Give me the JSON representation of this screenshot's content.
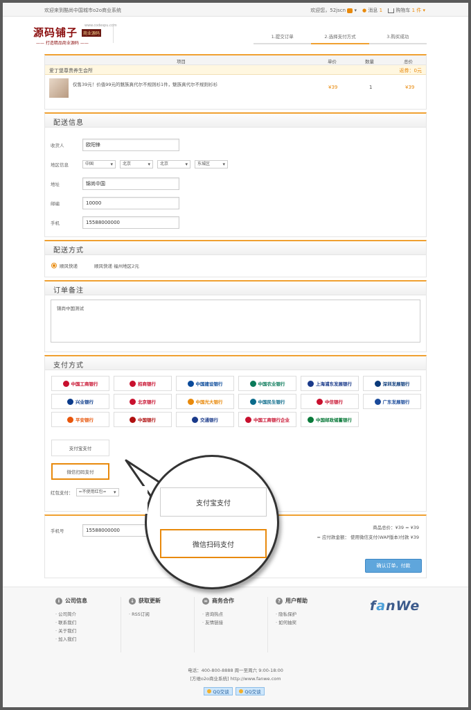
{
  "topbar": {
    "welcome": "欢迎来到酷尚中国城市o2o商业系统",
    "greeting": "欢迎您，52jscn",
    "messages": "消息",
    "message_count": "1",
    "cart": "购物车",
    "cart_count": "1 件"
  },
  "logo": {
    "name": "源码铺子",
    "badge": "商业源码",
    "site": "www.codespu.com",
    "slogan": "—— 打造精品商业源码 ——"
  },
  "steps": [
    "1.提交订单",
    "2.选择支付方式",
    "3.购买成功"
  ],
  "active_step": 1,
  "cart": {
    "headers": {
      "item": "项目",
      "price": "单价",
      "qty": "数量",
      "total": "总价"
    },
    "shop_name": "爱丁堡尊贵养生会所",
    "rebate": "返券：0元",
    "product": {
      "name": "仅售39元！价值99元的魅族真代尔不规则衫1件，魅族真代尔不规则衫衫",
      "price": "¥39",
      "qty": "1",
      "total": "¥39"
    }
  },
  "delivery": {
    "title": "配送信息",
    "consignee_label": "收货人",
    "consignee": "欧阳锋",
    "region_label": "地区信息",
    "regions": [
      "中国",
      "北京",
      "北京",
      "东城区"
    ],
    "address_label": "地址",
    "address": "锦尚中国",
    "zip_label": "邮编",
    "zip": "10000",
    "phone_label": "手机",
    "phone": "15588000000"
  },
  "shipping": {
    "title": "配送方式",
    "option": "顺风快递",
    "desc": "顺风快递 福州地区2元"
  },
  "remark": {
    "title": "订单备注",
    "text": "锦尚中国测试"
  },
  "payment": {
    "title": "支付方式",
    "banks": [
      {
        "name": "中国工商银行",
        "color": "#c8102e"
      },
      {
        "name": "招商银行",
        "color": "#c8102e"
      },
      {
        "name": "中国建设银行",
        "color": "#0a4a9a"
      },
      {
        "name": "中国农业银行",
        "color": "#0a7a5a"
      },
      {
        "name": "上海浦东发展银行",
        "color": "#1a3a8a"
      },
      {
        "name": "深圳发展银行",
        "color": "#0a3a7a"
      },
      {
        "name": "兴业银行",
        "color": "#0a3a8a"
      },
      {
        "name": "北京银行",
        "color": "#c8102e"
      },
      {
        "name": "中国光大银行",
        "color": "#e8890b"
      },
      {
        "name": "中国民生银行",
        "color": "#0a6a8a"
      },
      {
        "name": "中信银行",
        "color": "#c8102e"
      },
      {
        "name": "广东发展银行",
        "color": "#1a4a9a"
      },
      {
        "name": "平安银行",
        "color": "#e8560b"
      },
      {
        "name": "中国银行",
        "color": "#b01010"
      },
      {
        "name": "交通银行",
        "color": "#1a3a8a"
      },
      {
        "name": "中国工商银行企业",
        "color": "#c8102e"
      },
      {
        "name": "中国邮政储蓄银行",
        "color": "#0a7a3a"
      }
    ],
    "alipay": "支付宝支付",
    "wechat": "微信扫码支付",
    "redpack_label": "红包支付：",
    "redpack_value": "=不使用红包="
  },
  "checkout": {
    "phone_label": "手机号",
    "phone": "15588000000",
    "goods_total": "商品总价：¥39 = ¥39",
    "payable": "= 应付款金额： 使用微信支付(WAP版本)付款 ¥39",
    "confirm": "确认订单，付款"
  },
  "footer": {
    "columns": [
      {
        "title": "公司信息",
        "icon": "i",
        "items": [
          "公司简介",
          "联系我们",
          "关于我们",
          "加入我们"
        ]
      },
      {
        "title": "获取更新",
        "icon": "↓",
        "items": [
          "RSS订阅"
        ]
      },
      {
        "title": "商务合作",
        "icon": "∞",
        "items": [
          "咨询热点",
          "友情链接"
        ]
      },
      {
        "title": "用户帮助",
        "icon": "?",
        "items": [
          "隐私保护",
          "如何抽奖"
        ]
      }
    ],
    "brand": "fanWe",
    "hotline": "电话：400-800-8888 周一至周六 9:00-18:00",
    "copyright": "[方维o2o商业系统] http://www.fanwe.com",
    "qq": [
      "QQ交谈",
      "QQ交谈"
    ]
  },
  "callout": {
    "alipay": "支付宝支付",
    "wechat": "微信扫码支付"
  },
  "colors": {
    "accent": "#f0a030",
    "price": "#e8890b",
    "button": "#5fa6dc",
    "brand": "#8b0f0f"
  }
}
